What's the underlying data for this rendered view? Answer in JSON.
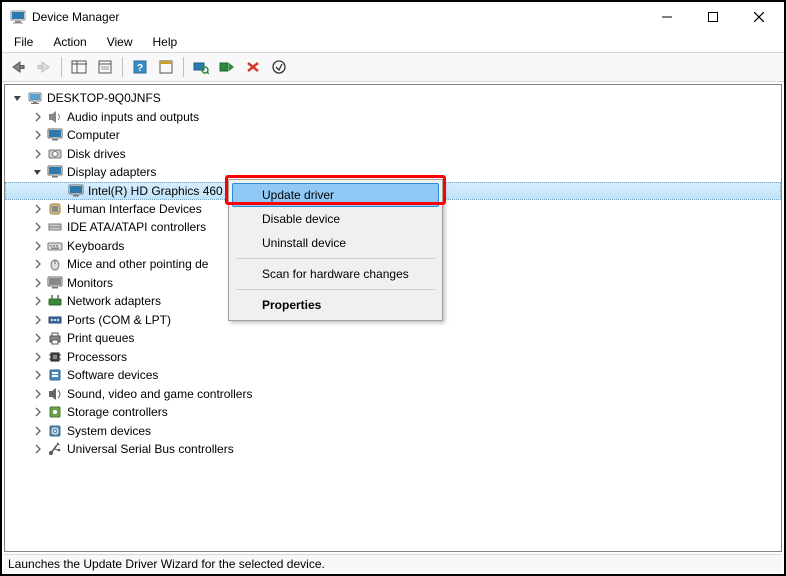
{
  "window": {
    "title": "Device Manager"
  },
  "menus": {
    "file": "File",
    "action": "Action",
    "view": "View",
    "help": "Help"
  },
  "tree": {
    "root": "DESKTOP-9Q0JNFS",
    "categories": [
      {
        "label": "Audio inputs and outputs",
        "icon": "speaker"
      },
      {
        "label": "Computer",
        "icon": "monitor-blue"
      },
      {
        "label": "Disk drives",
        "icon": "drive"
      },
      {
        "label": "Display adapters",
        "icon": "monitor-blue",
        "expanded": true,
        "children": [
          {
            "label": "Intel(R) HD Graphics 460",
            "icon": "monitor-blue",
            "selected": true
          }
        ]
      },
      {
        "label": "Human Interface Devices",
        "icon": "hid"
      },
      {
        "label": "IDE ATA/ATAPI controllers",
        "icon": "ide"
      },
      {
        "label": "Keyboards",
        "icon": "keyboard"
      },
      {
        "label": "Mice and other pointing de",
        "icon": "mouse"
      },
      {
        "label": "Monitors",
        "icon": "monitor"
      },
      {
        "label": "Network adapters",
        "icon": "network"
      },
      {
        "label": "Ports (COM & LPT)",
        "icon": "port"
      },
      {
        "label": "Print queues",
        "icon": "printer"
      },
      {
        "label": "Processors",
        "icon": "cpu"
      },
      {
        "label": "Software devices",
        "icon": "software"
      },
      {
        "label": "Sound, video and game controllers",
        "icon": "sound"
      },
      {
        "label": "Storage controllers",
        "icon": "storage"
      },
      {
        "label": "System devices",
        "icon": "system"
      },
      {
        "label": "Universal Serial Bus controllers",
        "icon": "usb"
      }
    ]
  },
  "context_menu": {
    "items": [
      {
        "label": "Update driver",
        "highlight": true
      },
      {
        "label": "Disable device"
      },
      {
        "label": "Uninstall device"
      },
      {
        "sep": true
      },
      {
        "label": "Scan for hardware changes"
      },
      {
        "sep": true
      },
      {
        "label": "Properties",
        "bold": true
      }
    ]
  },
  "status": "Launches the Update Driver Wizard for the selected device."
}
